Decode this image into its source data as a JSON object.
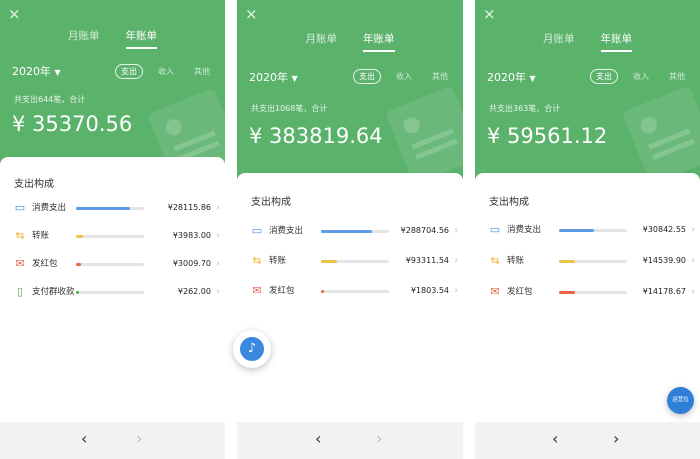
{
  "close_icon": "×",
  "tabs": [
    "月账单",
    "年账单"
  ],
  "year": "2020年",
  "segments": [
    "支出",
    "收入",
    "其他"
  ],
  "section_title": "支出构成",
  "nav": {
    "prev": "‹",
    "next": "›"
  },
  "fab_right_label": "运营位",
  "screens": [
    {
      "summary": "共支出644笔，合计",
      "total": "¥ 35370.56",
      "categories": [
        {
          "icon": "wallet-icon",
          "label": "消费支出",
          "value": "¥28115.86",
          "share": 0.8,
          "color": "#5b9be6"
        },
        {
          "icon": "transfer-icon",
          "label": "转账",
          "value": "¥3983.00",
          "share": 0.11,
          "color": "#f0c24b"
        },
        {
          "icon": "red-envelope-icon",
          "label": "发红包",
          "value": "¥3009.70",
          "share": 0.08,
          "color": "#e8634a"
        },
        {
          "icon": "group-payment-icon",
          "label": "支付群收款",
          "value": "¥262.00",
          "share": 0.03,
          "color": "#4caf50"
        }
      ],
      "next_enabled": false
    },
    {
      "summary": "共支出1068笔，合计",
      "total": "¥ 383819.64",
      "categories": [
        {
          "icon": "wallet-icon",
          "label": "消费支出",
          "value": "¥288704.56",
          "share": 0.75,
          "color": "#5b9be6"
        },
        {
          "icon": "transfer-icon",
          "label": "转账",
          "value": "¥93311.54",
          "share": 0.24,
          "color": "#f0c24b"
        },
        {
          "icon": "red-envelope-icon",
          "label": "发红包",
          "value": "¥1803.54",
          "share": 0.05,
          "color": "#e8634a"
        }
      ],
      "next_enabled": false
    },
    {
      "summary": "共支出363笔，合计",
      "total": "¥ 59561.12",
      "categories": [
        {
          "icon": "wallet-icon",
          "label": "消费支出",
          "value": "¥30842.55",
          "share": 0.52,
          "color": "#5b9be6"
        },
        {
          "icon": "transfer-icon",
          "label": "转账",
          "value": "¥14539.90",
          "share": 0.24,
          "color": "#f0c24b"
        },
        {
          "icon": "red-envelope-icon",
          "label": "发红包",
          "value": "¥14178.67",
          "share": 0.24,
          "color": "#e8634a"
        }
      ],
      "next_enabled": true
    }
  ]
}
